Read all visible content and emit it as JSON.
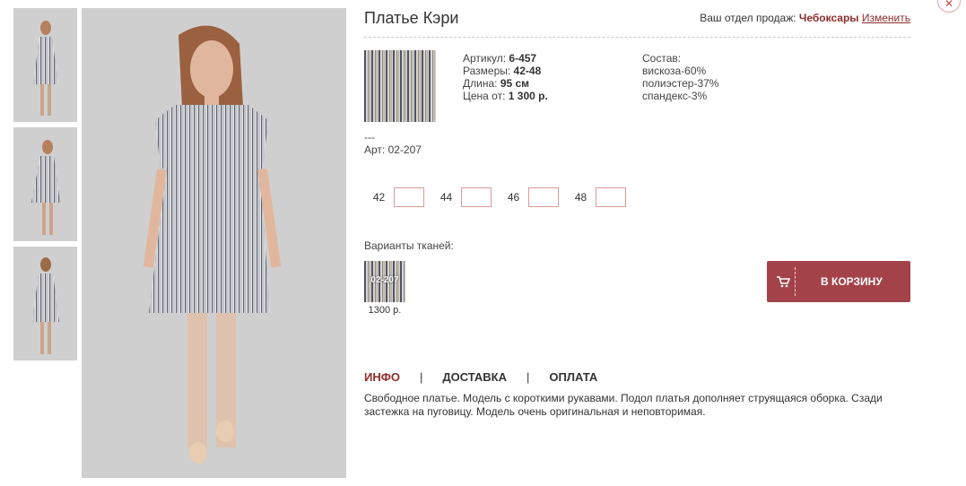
{
  "product": {
    "title": "Платье Кэри",
    "dashes": "---",
    "art": "Арт: 02-207"
  },
  "region": {
    "label": "Ваш отдел продаж: ",
    "city": "Чебоксары",
    "change": "Изменить"
  },
  "specs": [
    {
      "label": "Артикул: ",
      "value": "6-457"
    },
    {
      "label": "Размеры: ",
      "value": "42-48"
    },
    {
      "label": "Длина: ",
      "value": "95 см"
    },
    {
      "label": "Цена от: ",
      "value": "1 300 р."
    }
  ],
  "composition": {
    "title": "Состав:",
    "items": [
      "вискоза-60%",
      "полиэстер-37%",
      "спандекс-3%"
    ]
  },
  "sizes": [
    "42",
    "44",
    "46",
    "48"
  ],
  "fabric": {
    "label": "Варианты тканей:",
    "code": "02-207",
    "price": "1300 р."
  },
  "cart": {
    "label": "В КОРЗИНУ",
    "icon": "cart-icon"
  },
  "tabs": [
    "ИНФО",
    "ДОСТАВКА",
    "ОПЛАТА"
  ],
  "description": "Свободное платье. Модель с короткими рукавами. Подол платья дополняет струящаяся оборка. Сзади застежка на пуговицу. Модель очень оригинальная и неповторимая.",
  "close": {
    "icon": "close-icon",
    "glyph": "✕"
  },
  "colors": {
    "accent": "#8f2d2d",
    "button": "#a4424a",
    "input_border": "#d99a9a"
  }
}
